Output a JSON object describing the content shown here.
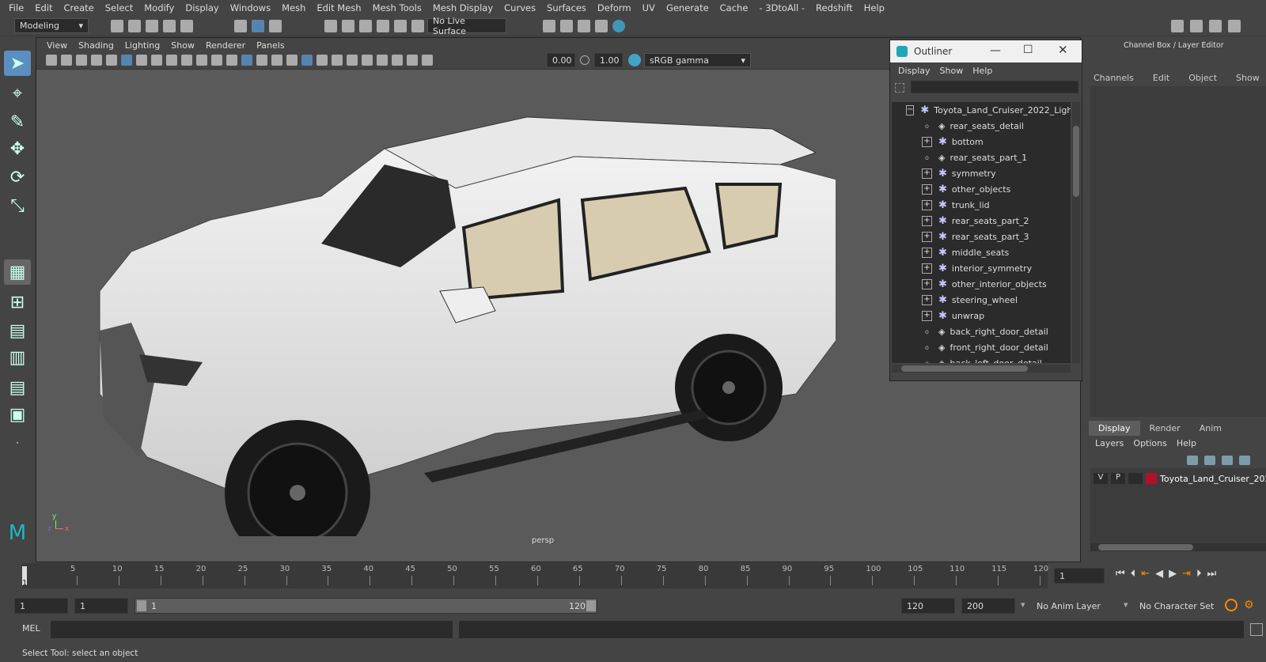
{
  "menubar": [
    "File",
    "Edit",
    "Create",
    "Select",
    "Modify",
    "Display",
    "Windows",
    "Mesh",
    "Edit Mesh",
    "Mesh Tools",
    "Mesh Display",
    "Curves",
    "Surfaces",
    "Deform",
    "UV",
    "Generate",
    "Cache",
    "- 3DtoAll -",
    "Redshift",
    "Help"
  ],
  "shelf": {
    "workspace": "Modeling",
    "live_surface": "No Live Surface"
  },
  "viewport": {
    "menu": [
      "View",
      "Shading",
      "Lighting",
      "Show",
      "Renderer",
      "Panels"
    ],
    "exposure": "0.00",
    "gamma": "1.00",
    "colorspace": "sRGB gamma",
    "camera": "persp",
    "axis_x": "x",
    "axis_y": "y",
    "axis_z": "z"
  },
  "outliner": {
    "title": "Outliner",
    "menu": [
      "Display",
      "Show",
      "Help"
    ],
    "items": [
      {
        "label": "Toyota_Land_Cruiser_2022_Ligh",
        "kind": "group",
        "expander": "−"
      },
      {
        "label": "rear_seats_detail",
        "kind": "mesh",
        "expander": "o"
      },
      {
        "label": "bottom",
        "kind": "group",
        "expander": "+"
      },
      {
        "label": "rear_seats_part_1",
        "kind": "mesh",
        "expander": "o"
      },
      {
        "label": "symmetry",
        "kind": "group",
        "expander": "+"
      },
      {
        "label": "other_objects",
        "kind": "group",
        "expander": "+"
      },
      {
        "label": "trunk_lid",
        "kind": "group",
        "expander": "+"
      },
      {
        "label": "rear_seats_part_2",
        "kind": "group",
        "expander": "+"
      },
      {
        "label": "rear_seats_part_3",
        "kind": "group",
        "expander": "+"
      },
      {
        "label": "middle_seats",
        "kind": "group",
        "expander": "+"
      },
      {
        "label": "interior_symmetry",
        "kind": "group",
        "expander": "+"
      },
      {
        "label": "other_interior_objects",
        "kind": "group",
        "expander": "+"
      },
      {
        "label": "steering_wheel",
        "kind": "group",
        "expander": "+"
      },
      {
        "label": "unwrap",
        "kind": "group",
        "expander": "+"
      },
      {
        "label": "back_right_door_detail",
        "kind": "mesh",
        "expander": "o"
      },
      {
        "label": "front_right_door_detail",
        "kind": "mesh",
        "expander": "o"
      },
      {
        "label": "back_left_door_detail",
        "kind": "mesh",
        "expander": "o"
      }
    ]
  },
  "channelbox": {
    "title": "Channel Box / Layer Editor",
    "menu": [
      "Channels",
      "Edit",
      "Object",
      "Show"
    ]
  },
  "layers": {
    "tabs": [
      "Display",
      "Render",
      "Anim"
    ],
    "menu": [
      "Layers",
      "Options",
      "Help"
    ],
    "row": {
      "v": "V",
      "p": "P",
      "name": "Toyota_Land_Cruiser_202",
      "color": "#b0102a"
    }
  },
  "timeline": {
    "ticks": [
      "5",
      "10",
      "15",
      "20",
      "25",
      "30",
      "35",
      "40",
      "45",
      "50",
      "55",
      "60",
      "65",
      "70",
      "75",
      "80",
      "85",
      "90",
      "95",
      "100",
      "105",
      "110",
      "115",
      "120"
    ],
    "current_frame": "1",
    "start_label": "1"
  },
  "range": {
    "start": "1",
    "start2": "1",
    "slider_start": "1",
    "slider_end": "120",
    "end": "120",
    "end2": "200",
    "anim_layer": "No Anim Layer",
    "char_set": "No Character Set"
  },
  "cmd": {
    "label": "MEL"
  },
  "help": "Select Tool: select an object"
}
